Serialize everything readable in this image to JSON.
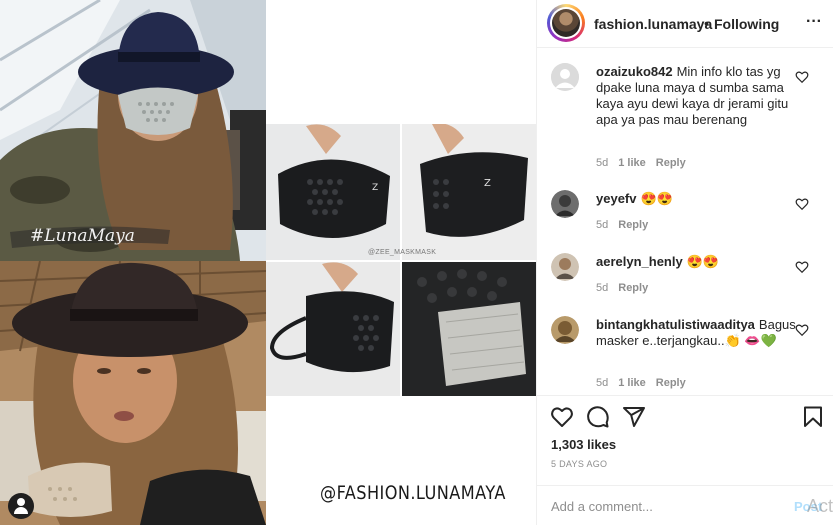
{
  "post": {
    "username": "fashion.lunamaya",
    "separator": "•",
    "follow_status": "Following",
    "more_icon": "more-horizontal-icon",
    "photo_watermark_script": "#LunaMaya",
    "photo_watermark_handle": "@FASHION.LUNAMAYA",
    "photo_watermark_small": "@ZEE_MASKMASK"
  },
  "comments": [
    {
      "username": "ozaizuko842",
      "text": "Min info klo tas yg dpake luna maya d sumba sama kaya ayu dewi kaya dr jerami gitu apa ya pas mau berenang",
      "time": "5d",
      "likes": "1 like",
      "reply": "Reply",
      "avatar": "default-avatar"
    },
    {
      "username": "yeyefv",
      "text": "😍😍",
      "time": "5d",
      "likes": "",
      "reply": "Reply",
      "avatar": "photo-avatar"
    },
    {
      "username": "aerelyn_henly",
      "text": "😍😍",
      "time": "5d",
      "likes": "",
      "reply": "Reply",
      "avatar": "photo-avatar"
    },
    {
      "username": "bintangkhatulistiwaaditya",
      "text": "Bagus masker e..terjangkau..👏 👄💚",
      "time": "5d",
      "likes": "1 like",
      "reply": "Reply",
      "avatar": "photo-avatar"
    }
  ],
  "actions": {
    "like_icon": "heart-icon",
    "comment_icon": "comment-icon",
    "share_icon": "paper-plane-icon",
    "save_icon": "bookmark-icon",
    "likes_text": "1,303 likes",
    "time_ago": "5 DAYS AGO"
  },
  "add_comment": {
    "placeholder": "Add a comment...",
    "post_label": "Post",
    "overlay_text": "Act"
  },
  "colors": {
    "link_disabled": "#b2dffc",
    "meta_gray": "#8e8e8e",
    "text": "#262626",
    "border": "#efefef"
  }
}
